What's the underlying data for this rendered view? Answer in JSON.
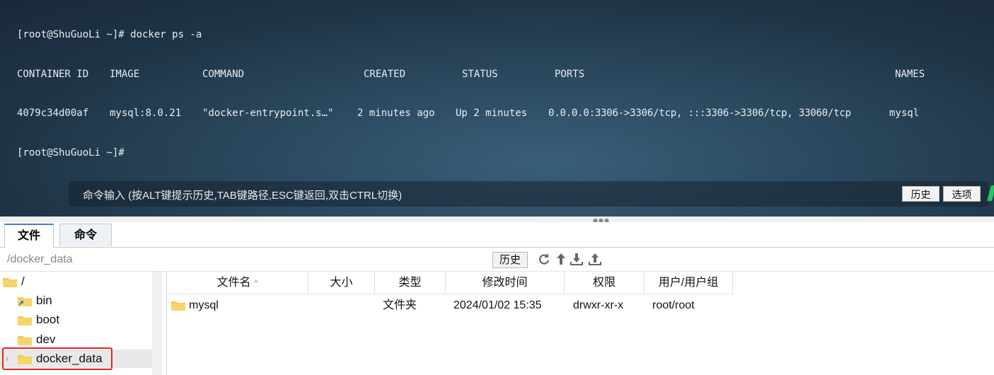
{
  "terminal": {
    "prompt_line_1": "[root@ShuGuoLi ~]# docker ps -a",
    "header": [
      "CONTAINER ID",
      "IMAGE",
      "COMMAND",
      "CREATED",
      "STATUS",
      "PORTS",
      "NAMES"
    ],
    "row": [
      "4079c34d00af",
      "mysql:8.0.21",
      "\"docker-entrypoint.s…\"",
      "2 minutes ago",
      "Up 2 minutes",
      "0.0.0.0:3306->3306/tcp, :::3306->3306/tcp, 33060/tcp",
      "mysql"
    ],
    "prompt_line_2": "[root@ShuGuoLi ~]#",
    "command_placeholder": "命令输入 (按ALT键提示历史,TAB键路径,ESC键返回,双击CTRL切换)",
    "history_button": "历史",
    "options_button": "选项"
  },
  "tabs": [
    {
      "label": "文件",
      "active": true
    },
    {
      "label": "命令",
      "active": false
    }
  ],
  "pathbar": {
    "path": "/docker_data",
    "history_button": "历史",
    "icons": [
      "refresh-icon",
      "go-up-icon",
      "download-icon",
      "upload-icon"
    ]
  },
  "tree": {
    "items": [
      {
        "label": "/",
        "icon": "folder-icon"
      },
      {
        "label": "bin",
        "icon": "folder-link-icon"
      },
      {
        "label": "boot",
        "icon": "folder-icon"
      },
      {
        "label": "dev",
        "icon": "folder-icon"
      },
      {
        "label": "docker_data",
        "icon": "folder-icon",
        "selected": true
      }
    ]
  },
  "filelist": {
    "columns": [
      "文件名",
      "大小",
      "类型",
      "修改时间",
      "权限",
      "用户/用户组"
    ],
    "sort_indicator": "^",
    "rows": [
      {
        "name": "mysql",
        "size": "",
        "type": "文件夹",
        "modified": "2024/01/02 15:35",
        "permissions": "drwxr-xr-x",
        "owner": "root/root"
      }
    ]
  },
  "colors": {
    "highlight_border": "#e8241c",
    "folder_yellow": "#f5c84c",
    "active_tab_accent": "#3c7fd0"
  }
}
